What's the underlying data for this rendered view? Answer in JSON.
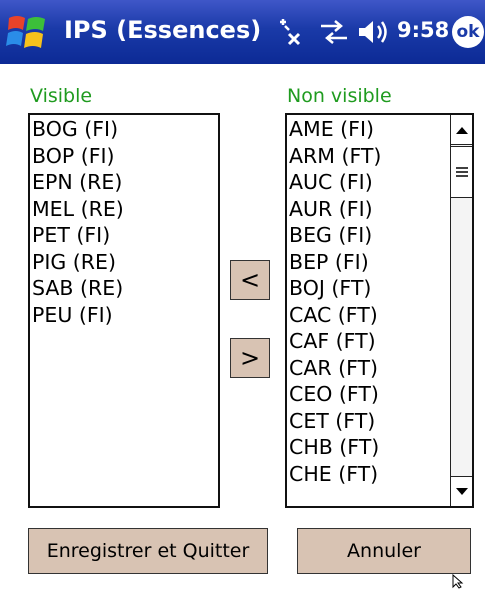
{
  "title_bar": {
    "app_title": "IPS (Essences)",
    "time": "9:58",
    "ok_label": "ok",
    "icons": [
      "windows-start-icon",
      "connectivity-icon",
      "signal-icon",
      "volume-icon"
    ]
  },
  "visible_list": {
    "label": "Visible",
    "items": [
      "BOG (FI)",
      "BOP (FI)",
      "EPN (RE)",
      "MEL (RE)",
      "PET (FI)",
      "PIG (RE)",
      "SAB (RE)",
      "PEU (FI)"
    ]
  },
  "non_visible_list": {
    "label": "Non visible",
    "items": [
      "AME (FI)",
      "ARM (FT)",
      "AUC (FI)",
      "AUR (FI)",
      "BEG (FI)",
      "BEP (FI)",
      "BOJ (FT)",
      "CAC (FT)",
      "CAF (FT)",
      "CAR (FT)",
      "CEO (FT)",
      "CET (FT)",
      "CHB (FT)",
      "CHE (FT)"
    ]
  },
  "move_buttons": {
    "to_visible": "<",
    "to_non_visible": ">"
  },
  "actions": {
    "save_quit": "Enregistrer et Quitter",
    "cancel": "Annuler"
  },
  "colors": {
    "title_bar": "#1a3aa8",
    "label_green": "#1f9b1f",
    "button_face": "#d8c3b3"
  }
}
